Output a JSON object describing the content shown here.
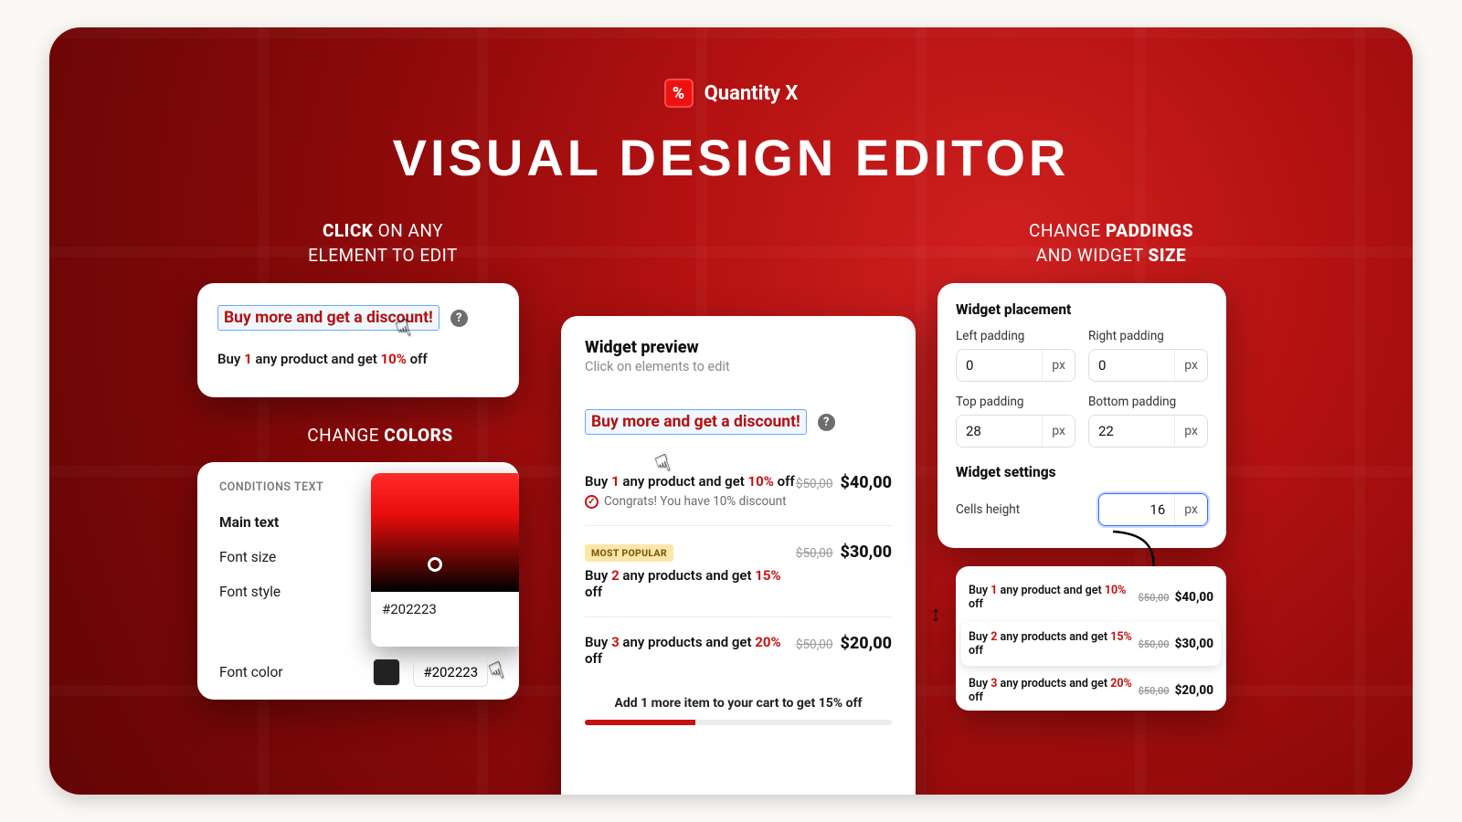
{
  "brand": {
    "name": "Quantity X"
  },
  "hero": "VISUAL DESIGN EDITOR",
  "captions": {
    "click_l1": "CLICK",
    "click_l2": " ON ANY",
    "click_l3": "ELEMENT TO EDIT",
    "colors_l1": "CHANGE ",
    "colors_l2": "COLORS",
    "pad_l1": "CHANGE ",
    "pad_l2": "PADDINGS",
    "pad_l3": "AND WIDGET ",
    "pad_l4": "SIZE"
  },
  "click_card": {
    "banner": "Buy more and get a discount!",
    "sub_pre": "Buy ",
    "sub_qty": "1",
    "sub_mid": " any product and get ",
    "sub_pct": "10%",
    "sub_post": " off"
  },
  "colors_card": {
    "section": "CONDITIONS TEXT",
    "opts": [
      "Main text",
      "Font size",
      "Font style",
      "Font color"
    ],
    "hex": "#202223",
    "chip_hex": "#202223"
  },
  "preview": {
    "title": "Widget preview",
    "subtitle": "Click on elements to edit",
    "banner": "Buy more and get a discount!",
    "tiers": [
      {
        "qty": "1",
        "noun": "any product and get",
        "pct": "10%",
        "congrats": "Congrats! You have 10% discount",
        "old": "$50,00",
        "new": "$40,00",
        "badge": ""
      },
      {
        "qty": "2",
        "noun": "any products and get",
        "pct": "15%",
        "congrats": "",
        "old": "$50,00",
        "new": "$30,00",
        "badge": "MOST POPULAR"
      },
      {
        "qty": "3",
        "noun": "any products and get",
        "pct": "20%",
        "congrats": "",
        "old": "$50,00",
        "new": "$20,00",
        "badge": ""
      }
    ],
    "motivator": "Add 1 more item to your cart to get 15% off"
  },
  "placement": {
    "section": "Widget placement",
    "left_l": "Left padding",
    "left_v": "0",
    "right_l": "Right padding",
    "right_v": "0",
    "top_l": "Top padding",
    "top_v": "28",
    "bot_l": "Bottom padding",
    "bot_v": "22",
    "settings": "Widget settings",
    "cells_l": "Cells height",
    "cells_v": "16",
    "unit": "px"
  },
  "mini": {
    "rows": [
      {
        "qty": "1",
        "noun": "any product and get",
        "pct": "10%",
        "old": "$50,00",
        "new": "$40,00"
      },
      {
        "qty": "2",
        "noun": "any products and get",
        "pct": "15%",
        "old": "$50,00",
        "new": "$30,00"
      },
      {
        "qty": "3",
        "noun": "any products and get",
        "pct": "20%",
        "old": "$50,00",
        "new": "$20,00"
      }
    ]
  }
}
